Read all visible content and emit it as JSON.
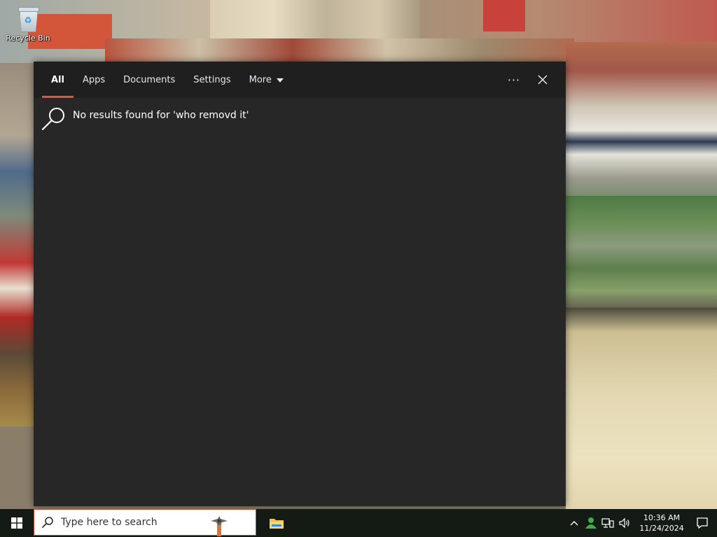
{
  "desktop": {
    "recycle_bin_label": "Recycle Bin"
  },
  "search_panel": {
    "tabs": [
      {
        "label": "All",
        "active": true
      },
      {
        "label": "Apps",
        "active": false
      },
      {
        "label": "Documents",
        "active": false
      },
      {
        "label": "Settings",
        "active": false
      },
      {
        "label": "More",
        "active": false,
        "dropdown": true
      }
    ],
    "more_options_icon": "ellipsis-icon",
    "close_icon": "close-icon",
    "no_results_icon": "search-icon",
    "no_results_message": "No results found for 'who removd it'"
  },
  "taskbar": {
    "start_icon": "windows-logo-icon",
    "search": {
      "placeholder": "Type here to search",
      "value": "",
      "icon": "search-icon"
    },
    "pinned": [
      {
        "name": "File Explorer",
        "icon": "folder-icon"
      }
    ],
    "tray": {
      "icons": [
        "chevron-up-icon",
        "person-icon",
        "network-icon",
        "volume-icon"
      ],
      "time": "10:36 AM",
      "date": "11/24/2024",
      "notification_icon": "notification-icon"
    }
  },
  "colors": {
    "panel_bg": "#272727",
    "header_bg": "#1f1f1f",
    "accent": "#e4533a",
    "taskbar_bg": "#141a14",
    "search_border": "#d9402c"
  }
}
